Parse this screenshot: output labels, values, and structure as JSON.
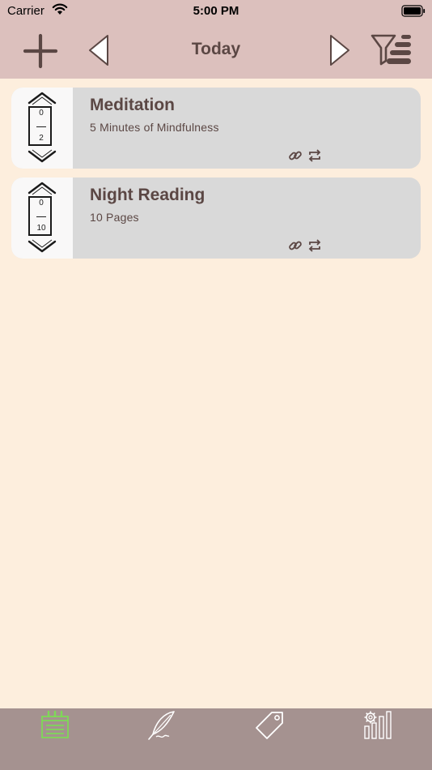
{
  "status_bar": {
    "carrier": "Carrier",
    "time": "5:00 PM"
  },
  "header": {
    "title": "Today"
  },
  "habits": [
    {
      "title": "Meditation",
      "subtitle": "5 Minutes of Mindfulness",
      "done": "0",
      "goal": "2"
    },
    {
      "title": "Night Reading",
      "subtitle": "10 Pages",
      "done": "0",
      "goal": "10"
    }
  ],
  "icons": {
    "add": "plus-icon",
    "prev": "triangle-left-icon",
    "next": "triangle-right-icon",
    "filter": "filter-sort-icon",
    "link": "link-icon",
    "repeat": "repeat-icon",
    "tab_habits": "checklist-icon",
    "tab_journal": "quill-icon",
    "tab_tags": "tag-icon",
    "tab_stats": "stats-gear-icon"
  },
  "colors": {
    "header_bg": "#dcc0bd",
    "page_bg": "#fdeedd",
    "card_bg": "#d9d9d9",
    "text": "#5b4744",
    "tab_bar_bg": "#a59290",
    "tab_active": "#7ed957"
  }
}
